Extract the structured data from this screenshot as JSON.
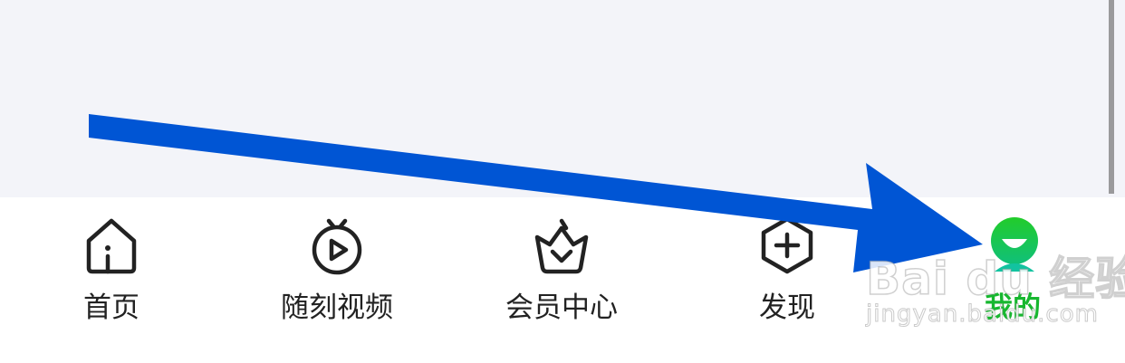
{
  "tabbar": {
    "tabs": [
      {
        "label": "首页",
        "icon": "home-icon",
        "active": false
      },
      {
        "label": "随刻视频",
        "icon": "video-play-icon",
        "active": false
      },
      {
        "label": "会员中心",
        "icon": "vip-basket-icon",
        "active": false
      },
      {
        "label": "发现",
        "icon": "hexagon-plus-icon",
        "active": false
      },
      {
        "label": "我的",
        "icon": "profile-avatar-icon",
        "active": true
      }
    ]
  },
  "colors": {
    "active_tab": "#17b72f",
    "inactive_tab": "#222222",
    "annotation_arrow": "#0055d4",
    "content_bg": "#f3f4f9"
  },
  "watermark": {
    "logo": "Bai du 经验",
    "url": "jingyan.baidu.com"
  }
}
